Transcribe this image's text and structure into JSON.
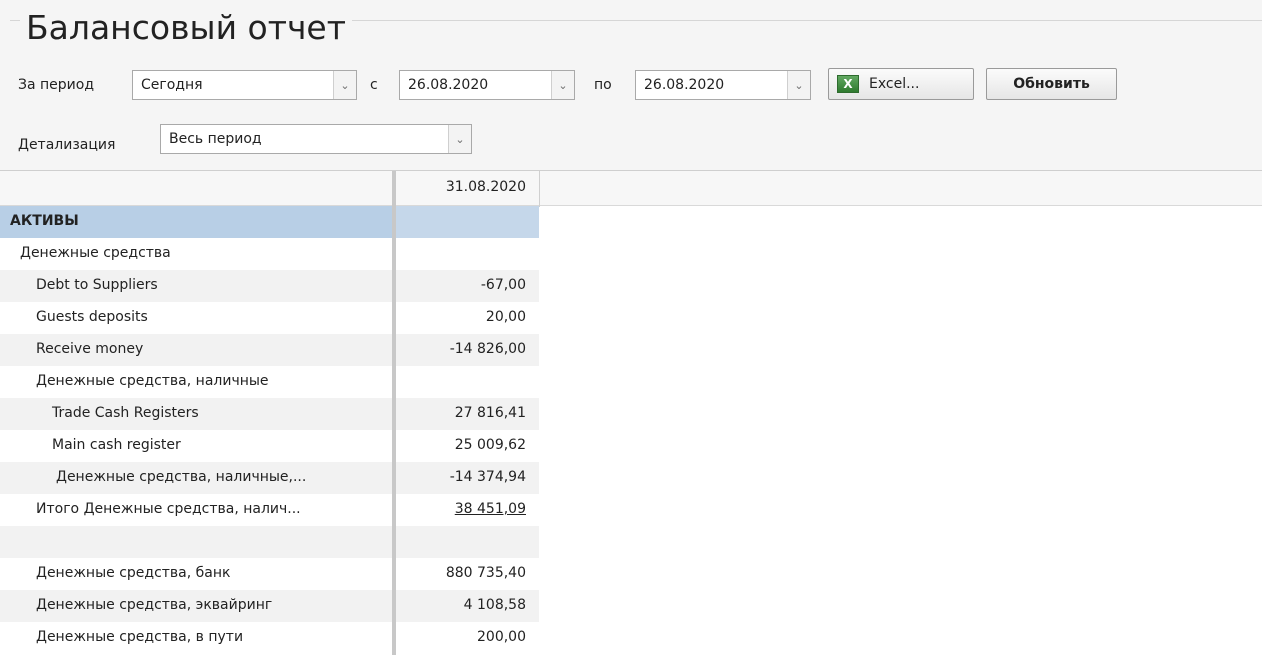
{
  "title": "Балансовый отчет",
  "filters": {
    "period_label": "За период",
    "period_value": "Сегодня",
    "from_label": "с",
    "from_date": "26.08.2020",
    "to_label": "по",
    "to_date": "26.08.2020",
    "excel_label": "Excel...",
    "excel_icon": "X",
    "refresh_label": "Обновить",
    "detail_label": "Детализация",
    "detail_value": "Весь период",
    "dropdown_glyph": "⌄"
  },
  "table": {
    "date_header": "31.08.2020",
    "rows": [
      {
        "name": "АКТИВЫ",
        "value": "",
        "section": true
      },
      {
        "name": "Денежные средства",
        "value": ""
      },
      {
        "name": "Debt to Suppliers",
        "value": "-67,00"
      },
      {
        "name": "Guests deposits",
        "value": "20,00"
      },
      {
        "name": "Receive money",
        "value": "-14 826,00"
      },
      {
        "name": "Денежные средства, наличные",
        "value": ""
      },
      {
        "name": "Trade Cash Registers",
        "value": "27 816,41"
      },
      {
        "name": "Main cash register",
        "value": "25 009,62"
      },
      {
        "name": "Денежные средства, наличные,...",
        "value": "-14 374,94"
      },
      {
        "name": "Итого Денежные средства, налич...",
        "value": "38 451,09",
        "total": true
      },
      {
        "name": "",
        "value": ""
      },
      {
        "name": "Денежные средства, банк",
        "value": "880 735,40"
      },
      {
        "name": "Денежные средства, эквайринг",
        "value": "4 108,58"
      },
      {
        "name": "Денежные средства, в пути",
        "value": "200,00"
      }
    ]
  },
  "colors": {
    "section_bg": "#b8cfe6",
    "alt_row_bg": "#f2f2f2"
  }
}
